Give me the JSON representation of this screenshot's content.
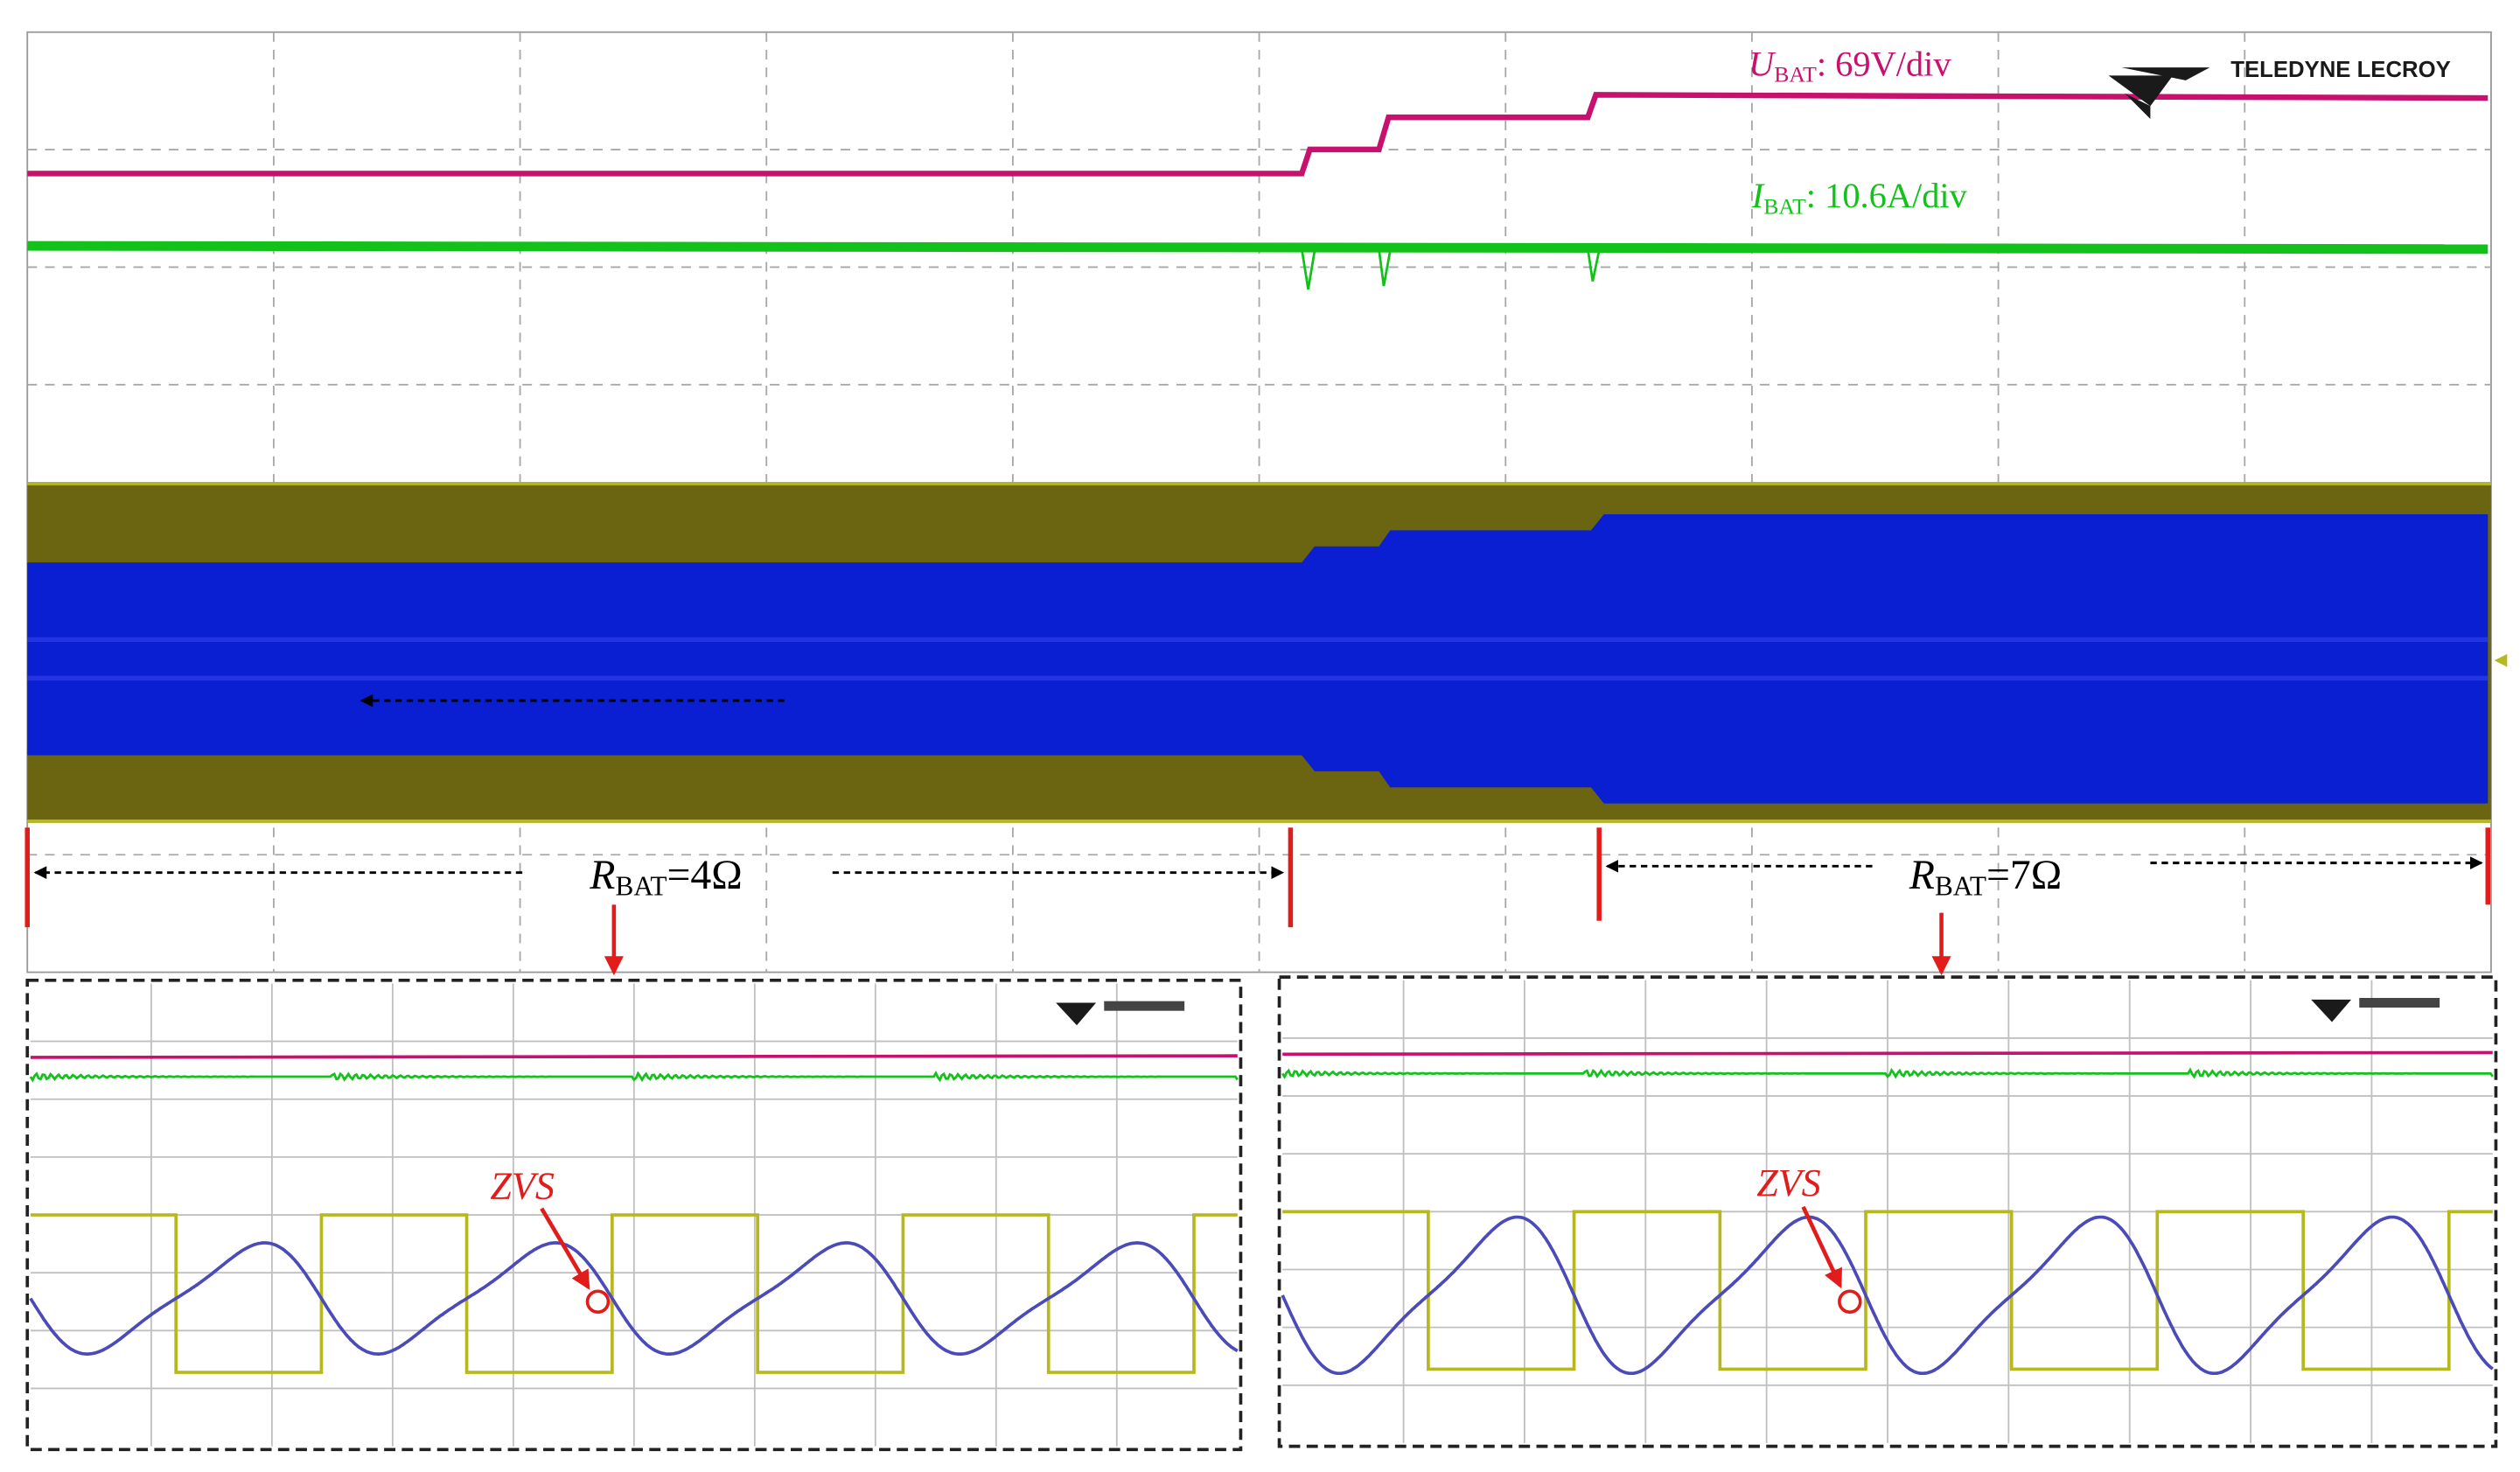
{
  "labels": {
    "u_bat_main": "U",
    "u_bat_sub": "BAT",
    "u_bat_rest": ": 69V/div",
    "i_bat_main": "I",
    "i_bat_sub": "BAT",
    "i_bat_rest": ": 10.6A/div",
    "r4_main": "R",
    "r4_sub": "BAT",
    "r4_rest": "=4Ω",
    "r7_main": "R",
    "r7_sub": "BAT",
    "r7_rest": "=7Ω",
    "zvs_left": "ZVS",
    "zvs_right": "ZVS",
    "logo_text": "TELEDYNE LECROY"
  },
  "colors": {
    "voltage": "#c8106e",
    "current": "#12c21a",
    "square_wave": "#6b6410",
    "square_wave_line": "#b6b81e",
    "resonant": "#0a1ed2",
    "resonant_line": "#4a4ab8",
    "annotation": "#e21b1b",
    "grid": "#a8a8a8"
  },
  "chart_data": [
    {
      "type": "line",
      "title": "",
      "series": [
        {
          "name": "U_BAT",
          "scale": "69V/div",
          "steps_div": [
            {
              "x": 0,
              "y": 1.0
            },
            {
              "x": 5.2,
              "y": 1.15
            },
            {
              "x": 5.6,
              "y": 1.3
            },
            {
              "x": 6.3,
              "y": 1.5
            }
          ]
        },
        {
          "name": "I_BAT",
          "scale": "10.6A/div",
          "steps_div": [
            {
              "x": 0,
              "y": 0.5
            },
            {
              "x": 10,
              "y": 0.5
            }
          ]
        }
      ],
      "load_steps": [
        {
          "label": "R_BAT=4Ω",
          "x_range_div": [
            0,
            5.2
          ]
        },
        {
          "label": "R_BAT=7Ω",
          "x_range_div": [
            6.3,
            10
          ]
        }
      ],
      "xlim_div": [
        0,
        10
      ],
      "grid": true
    },
    {
      "type": "line",
      "title": "",
      "panel": "zoom R_BAT=4Ω",
      "series": [
        {
          "name": "square_wave",
          "cycles": 4
        },
        {
          "name": "resonant_current",
          "cycles": 4
        }
      ],
      "annotations": [
        "ZVS"
      ],
      "grid": true
    },
    {
      "type": "line",
      "title": "",
      "panel": "zoom R_BAT=7Ω",
      "series": [
        {
          "name": "square_wave",
          "cycles": 4
        },
        {
          "name": "resonant_current",
          "cycles": 4
        }
      ],
      "annotations": [
        "ZVS"
      ],
      "grid": true
    }
  ]
}
